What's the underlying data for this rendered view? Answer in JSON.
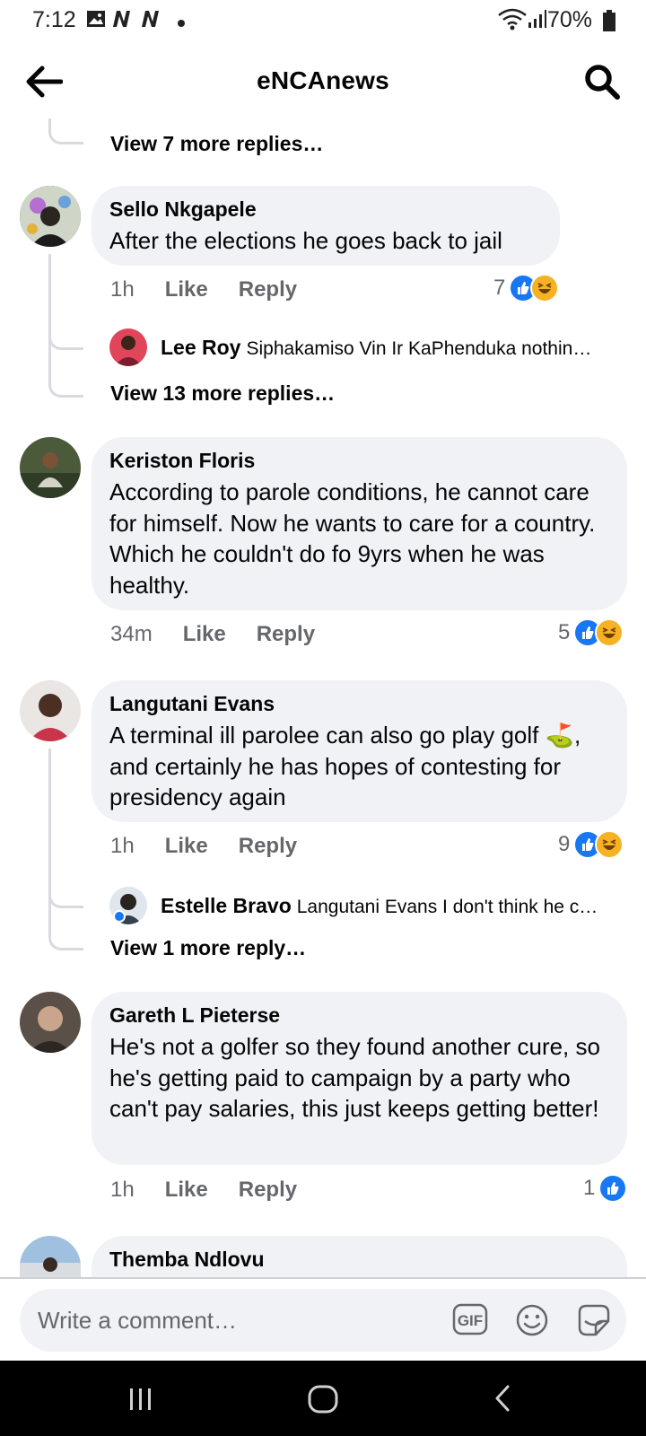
{
  "status_bar": {
    "time": "7:12",
    "battery": "70%"
  },
  "header": {
    "title": "eNCAnews"
  },
  "threads": [
    {
      "view_more": "View 7 more replies…"
    }
  ],
  "comments": [
    {
      "author": "Sello Nkgapele",
      "text": "After the elections he goes back to jail",
      "time": "1h",
      "like": "Like",
      "reply": "Reply",
      "reactions": "7",
      "replies": [
        {
          "author": "Lee Roy",
          "text": "Siphakamiso Vin Ir KaPhenduka nothin…"
        }
      ],
      "view_more": "View 13 more replies…"
    },
    {
      "author": "Keriston Floris",
      "text": "According to parole conditions, he cannot care for himself. Now he wants to care for a country. Which he couldn't do fo 9yrs when he was healthy.",
      "time": "34m",
      "like": "Like",
      "reply": "Reply",
      "reactions": "5"
    },
    {
      "author": "Langutani Evans",
      "text": "A terminal ill parolee can also go play golf ⛳, and certainly he has hopes of contesting for presidency again",
      "time": "1h",
      "like": "Like",
      "reply": "Reply",
      "reactions": "9",
      "replies": [
        {
          "author": "Estelle Bravo",
          "text": "Langutani Evans I don't think he c…"
        }
      ],
      "view_more": "View 1 more reply…"
    },
    {
      "author": "Gareth L Pieterse",
      "text": "He's not a golfer so they found another cure, so he's getting paid to campaign by a party who can't pay salaries, this just keeps getting better!",
      "time": "1h",
      "like": "Like",
      "reply": "Reply",
      "reactions": "1"
    },
    {
      "author": "Themba Ndlovu"
    }
  ],
  "composer": {
    "placeholder": "Write a comment…",
    "gif_label": "GIF"
  },
  "colors": {
    "like_blue": "#1877f2",
    "haha_yellow": "#f7b125",
    "bubble_bg": "#f0f2f5",
    "meta_gray": "#65676b"
  }
}
